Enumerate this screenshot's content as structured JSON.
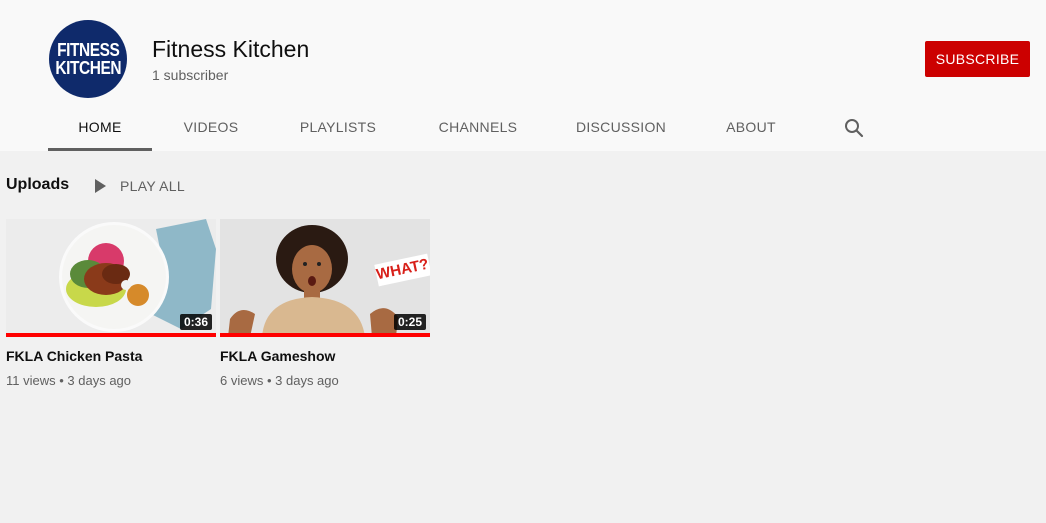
{
  "channel": {
    "logo_line1": "FITNESS",
    "logo_line2": "KITCHEN",
    "name": "Fitness Kitchen",
    "subscribers": "1 subscriber",
    "subscribe_label": "SUBSCRIBE",
    "brand_color": "#cc0000",
    "logo_color": "#0f2a6b"
  },
  "tabs": [
    {
      "label": "HOME",
      "active": true
    },
    {
      "label": "VIDEOS",
      "active": false
    },
    {
      "label": "PLAYLISTS",
      "active": false
    },
    {
      "label": "CHANNELS",
      "active": false
    },
    {
      "label": "DISCUSSION",
      "active": false
    },
    {
      "label": "ABOUT",
      "active": false
    }
  ],
  "search_icon": "search-icon",
  "uploads": {
    "title": "Uploads",
    "play_all_label": "PLAY ALL",
    "videos": [
      {
        "title": "FKLA Chicken Pasta",
        "duration": "0:36",
        "views": "11 views",
        "age": "3 days ago",
        "watched": 1.0
      },
      {
        "title": "FKLA Gameshow",
        "duration": "0:25",
        "views": "6 views",
        "age": "3 days ago",
        "watched": 1.0,
        "overlay_text": "WHAT?"
      }
    ]
  }
}
